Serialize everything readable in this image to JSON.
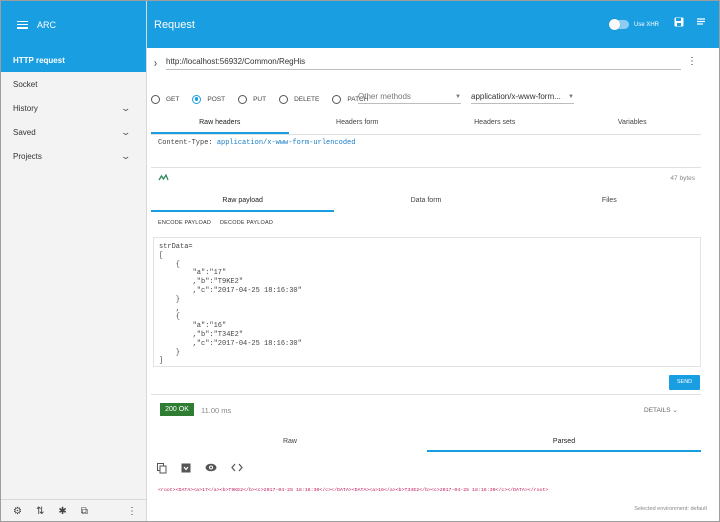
{
  "sidebar": {
    "app_name": "ARC",
    "items": [
      {
        "label": "HTTP request",
        "active": true,
        "expandable": false
      },
      {
        "label": "Socket",
        "active": false,
        "expandable": false
      },
      {
        "label": "History",
        "active": false,
        "expandable": true
      },
      {
        "label": "Saved",
        "active": false,
        "expandable": true
      },
      {
        "label": "Projects",
        "active": false,
        "expandable": true
      }
    ],
    "footer_icons": [
      "gear-icon",
      "sort-icon",
      "bug-icon",
      "open-external-icon",
      "more-vert-icon"
    ]
  },
  "header": {
    "title": "Request",
    "xhr_label": "Use XHR",
    "xhr_enabled": false,
    "icons": [
      "save-icon",
      "list-icon"
    ]
  },
  "url": {
    "value": "http://localhost:56932/Common/RegHis"
  },
  "methods": {
    "options": [
      "GET",
      "POST",
      "PUT",
      "DELETE",
      "PATCH"
    ],
    "selected": "POST",
    "other_methods_placeholder": "Other methods",
    "content_type": "application/x-www-form..."
  },
  "header_tabs": [
    "Raw headers",
    "Headers form",
    "Headers sets",
    "Variables"
  ],
  "headers_raw": {
    "key": "Content-Type:",
    "value": "application/x-www-form-urlencoded"
  },
  "payload_size": "47 bytes",
  "payload_tabs": [
    "Raw payload",
    "Data form",
    "Files"
  ],
  "payload_buttons": [
    "ENCODE PAYLOAD",
    "DECODE PAYLOAD"
  ],
  "payload_text": "strData=\n[\n    {\n        \"a\":\"17\"\n        ,\"b\":\"T9KE2\"\n        ,\"c\":\"2017-04-25 18:16:30\"\n    }\n    ,\n    {\n        \"a\":\"16\"\n        ,\"b\":\"T34E2\"\n        ,\"c\":\"2017-04-25 18:16:30\"\n    }\n]",
  "send_label": "SEND",
  "response": {
    "status": "200 OK",
    "time": "11.00 ms",
    "details_label": "DETAILS",
    "tabs": [
      "Raw",
      "Parsed"
    ],
    "active_tab": "Parsed",
    "icons": [
      "copy-icon",
      "save-download-icon",
      "eye-icon",
      "code-icon"
    ],
    "body": "<root><DATA><a>17</a><b>T9KE2</b><c>2017-04-25 18:16:30</c></DATA><DATA><a>16</a><b>T34E2</b><c>2017-04-25 18:16:30</c></DATA></root>"
  },
  "environment": "Selected environment: default",
  "colors": {
    "accent": "#1a9ee2",
    "status_ok": "#2e7d32"
  }
}
